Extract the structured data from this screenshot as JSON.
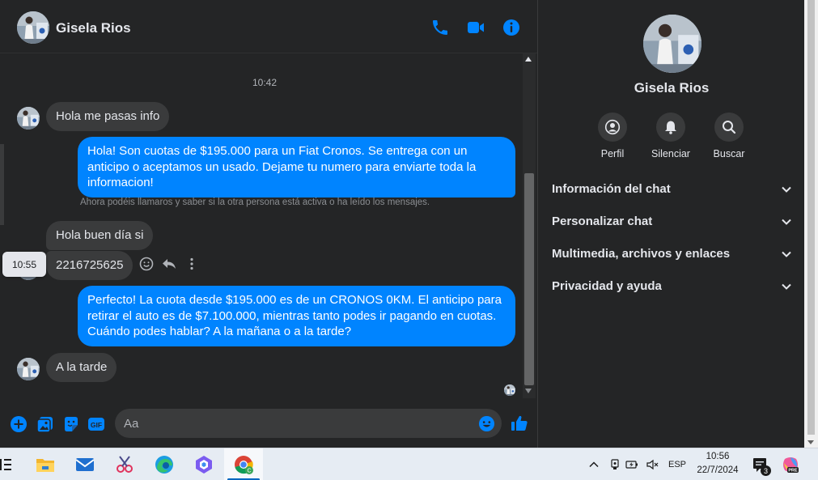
{
  "contact": {
    "name": "Gisela Rios"
  },
  "header": {
    "icons": [
      "phone-icon",
      "video-icon",
      "info-icon"
    ]
  },
  "conversation": {
    "timestamp_top": "10:42",
    "messages": [
      {
        "direction": "incoming",
        "text": "Hola me pasas info"
      },
      {
        "direction": "outgoing",
        "text": "Hola! Son cuotas de $195.000 para un Fiat Cronos. Se entrega con un anticipo o aceptamos un usado. Dejame tu numero para enviarte toda la informacion!"
      },
      {
        "direction": "incoming",
        "text": "Hola buen día si"
      },
      {
        "direction": "incoming",
        "text": "2216725625"
      },
      {
        "direction": "outgoing",
        "text": "Perfecto! La cuota desde $195.000 es de un CRONOS 0KM. El anticipo para retirar el auto es de $7.100.000, mientras tanto podes ir pagando en cuotas. Cuándo podes hablar? A la mañana o a la tarde?"
      },
      {
        "direction": "incoming",
        "text": "A la tarde"
      }
    ],
    "notice": "Ahora podéis llamaros y saber si la otra persona está activa o ha leído los mensajes.",
    "hover_tooltip_time": "10:55"
  },
  "composer": {
    "placeholder": "Aa"
  },
  "panel": {
    "name": "Gisela Rios",
    "actions": [
      {
        "label": "Perfil",
        "icon": "profile-icon"
      },
      {
        "label": "Silenciar",
        "icon": "bell-icon"
      },
      {
        "label": "Buscar",
        "icon": "search-icon"
      }
    ],
    "sections": [
      {
        "label": "Información del chat"
      },
      {
        "label": "Personalizar chat"
      },
      {
        "label": "Multimedia, archivos y enlaces"
      },
      {
        "label": "Privacidad y ayuda"
      }
    ]
  },
  "taskbar": {
    "language": "ESP",
    "time": "10:56",
    "date": "22/7/2024",
    "notification_count": "3"
  },
  "colors": {
    "bg": "#242526",
    "bubble_in": "#3a3b3c",
    "bubble_out": "#0084ff",
    "accent": "#0084ff",
    "text": "#e4e6eb"
  }
}
